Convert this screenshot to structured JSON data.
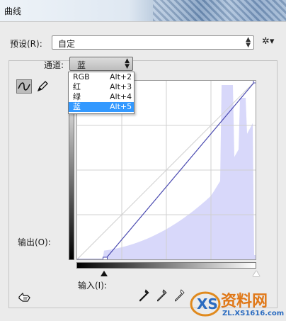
{
  "window": {
    "title": "曲线"
  },
  "preset": {
    "label": "预设(R):",
    "value": "自定",
    "menu_icon": "gear-icon"
  },
  "channel": {
    "label": "通道:",
    "value": "蓝",
    "options": [
      {
        "name": "RGB",
        "shortcut": "Alt+2"
      },
      {
        "name": "红",
        "shortcut": "Alt+3"
      },
      {
        "name": "绿",
        "shortcut": "Alt+4"
      },
      {
        "name": "蓝",
        "shortcut": "Alt+5",
        "selected": true
      }
    ]
  },
  "tools": {
    "curve_icon": "curve-tool-icon",
    "pencil_icon": "pencil-icon",
    "hand_icon": "hand-adjust-icon"
  },
  "graph": {
    "output_label": "输出(O):",
    "input_label": "输入(I):",
    "curve_points": [
      {
        "input": 40,
        "output": 0
      },
      {
        "input": 255,
        "output": 255
      }
    ],
    "histogram_color": "#d8d8fa",
    "curve_color": "#4a4ab0"
  },
  "eyedroppers": [
    "black-eyedropper-icon",
    "gray-eyedropper-icon",
    "white-eyedropper-icon"
  ],
  "watermark": {
    "brand": "资料网",
    "url": "ZL.XS1616.com"
  }
}
